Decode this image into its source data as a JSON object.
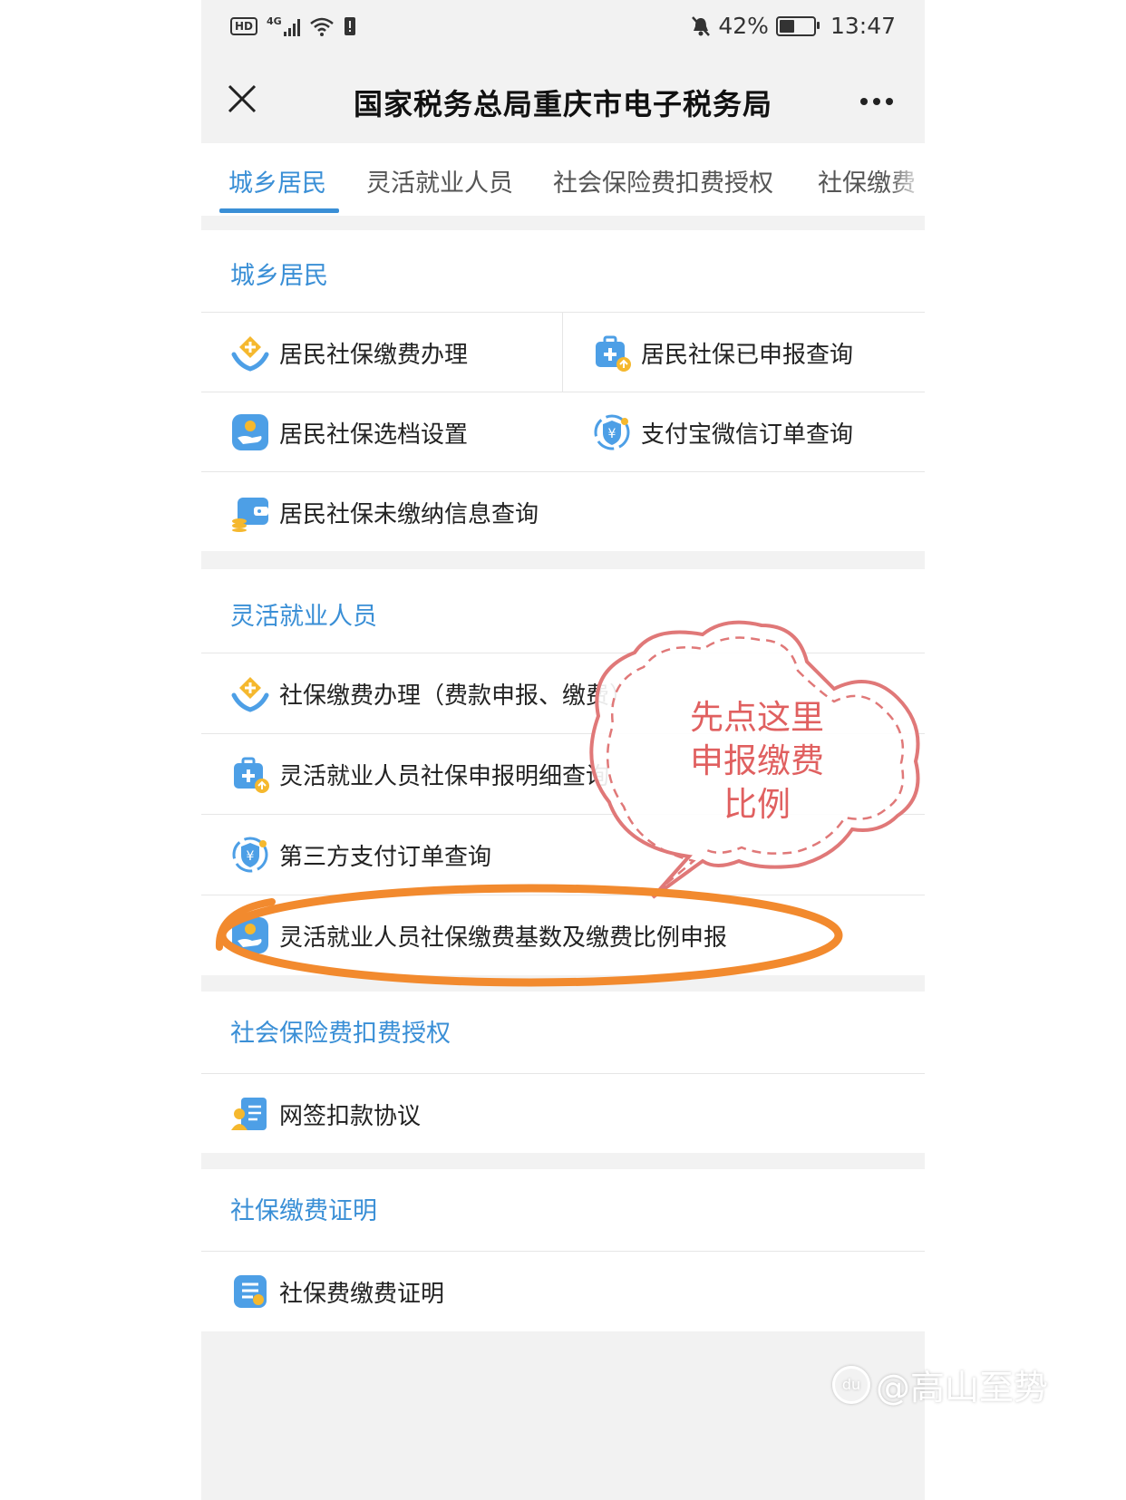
{
  "status_bar": {
    "network": "4G",
    "hd": "HD",
    "battery": "42%",
    "time": "13:47"
  },
  "nav": {
    "title": "国家税务总局重庆市电子税务局",
    "close_icon": "close-icon",
    "more_icon": "more-icon"
  },
  "tabs": [
    {
      "label": "城乡居民",
      "active": true
    },
    {
      "label": "灵活就业人员",
      "active": false
    },
    {
      "label": "社会保险费扣费授权",
      "active": false
    },
    {
      "label": "社保缴费",
      "active": false
    }
  ],
  "sections": {
    "urban_rural": {
      "title": "城乡居民",
      "items": [
        {
          "label": "居民社保缴费办理",
          "icon": "hands-coin-icon"
        },
        {
          "label": "居民社保已申报查询",
          "icon": "medkit-upload-icon"
        },
        {
          "label": "居民社保选档设置",
          "icon": "hand-card-icon"
        },
        {
          "label": "支付宝微信订单查询",
          "icon": "yuan-shield-icon"
        },
        {
          "label": "居民社保未缴纳信息查询",
          "icon": "wallet-coins-icon"
        }
      ]
    },
    "flexible": {
      "title": "灵活就业人员",
      "items": [
        {
          "label": "社保缴费办理（费款申报、缴费）",
          "icon": "hands-coin-icon"
        },
        {
          "label": "灵活就业人员社保申报明细查询",
          "icon": "medkit-upload-icon"
        },
        {
          "label": "第三方支付订单查询",
          "icon": "yuan-shield-icon"
        },
        {
          "label": "灵活就业人员社保缴费基数及缴费比例申报",
          "icon": "hand-card-icon"
        }
      ]
    },
    "authorization": {
      "title": "社会保险费扣费授权",
      "items": [
        {
          "label": "网签扣款协议",
          "icon": "contract-user-icon"
        }
      ]
    },
    "certificate": {
      "title": "社保缴费证明",
      "items": [
        {
          "label": "社保费缴费证明",
          "icon": "document-list-icon"
        }
      ]
    }
  },
  "annotation": {
    "bubble_lines": [
      "先点这里",
      "申报缴费",
      "比例"
    ],
    "bubble_color": "#e06060",
    "highlight_color": "#f28a2e"
  },
  "watermark": {
    "text": "@高山至势",
    "logo_text": "du"
  },
  "colors": {
    "accent": "#3a8fd6",
    "background": "#f2f2f2"
  }
}
